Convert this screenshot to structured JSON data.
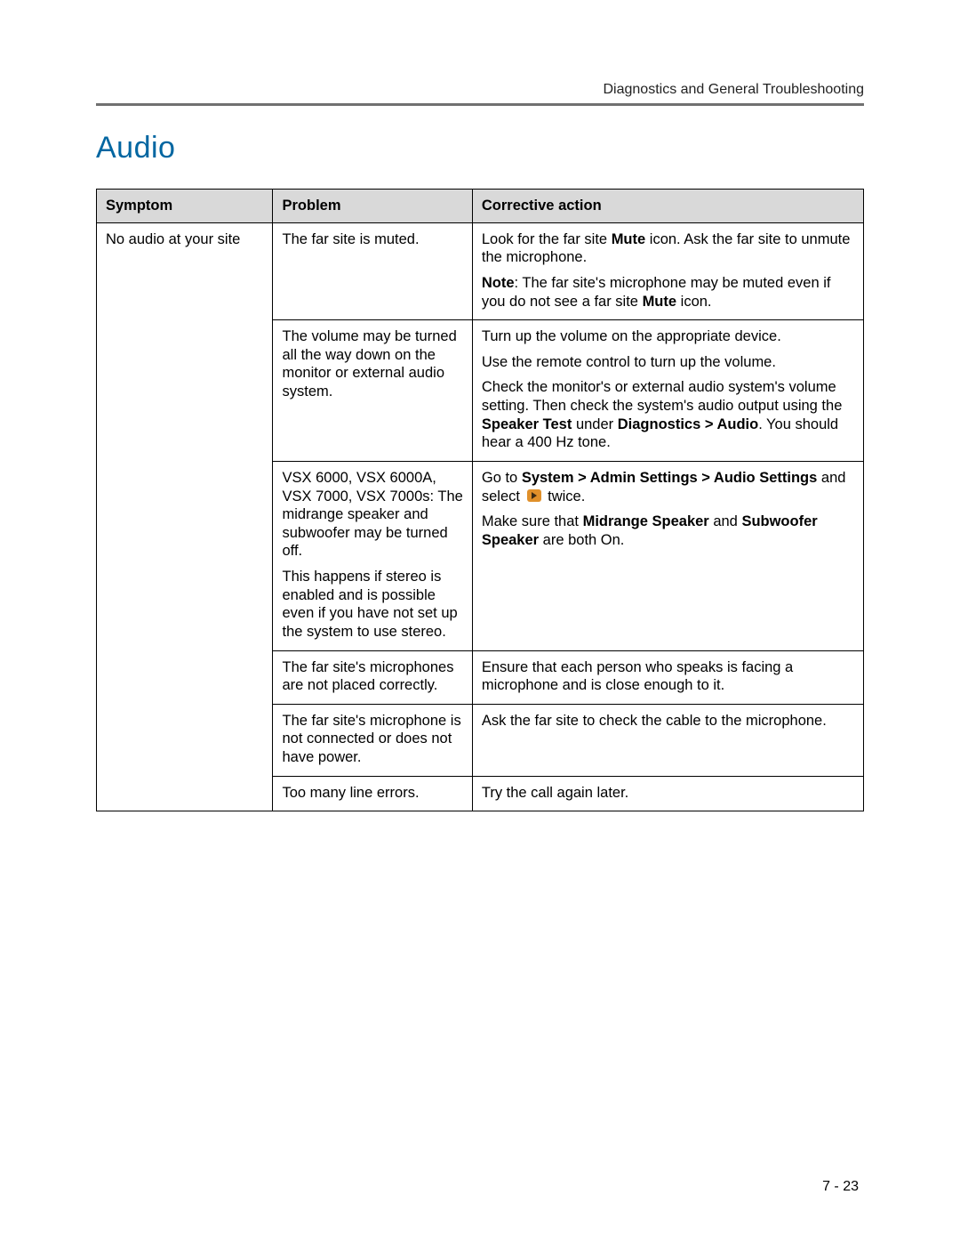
{
  "header": {
    "running": "Diagnostics and General Troubleshooting"
  },
  "section_title": "Audio",
  "table": {
    "headers": {
      "symptom": "Symptom",
      "problem": "Problem",
      "action": "Corrective action"
    },
    "symptom": "No audio at your site",
    "rows": [
      {
        "problem": "The far site is muted.",
        "action": {
          "pre1": "Look for the far site ",
          "b1": "Mute",
          "post1": " icon. Ask the far site to unmute the microphone.",
          "pre2": "Note",
          "post2": ": The far site's microphone may be muted even if you do not see a far site ",
          "b2": "Mute",
          "post3": " icon."
        }
      },
      {
        "problem": "The volume may be turned all the way down on the monitor or external audio system.",
        "action": {
          "p1": "Turn up the volume on the appropriate device.",
          "p2": "Use the remote control to turn up the volume.",
          "pre3": "Check the monitor's or external audio system's volume setting. Then check the system's audio output using the ",
          "b3a": "Speaker Test",
          "mid3": " under ",
          "b3b": "Diagnostics > Audio",
          "post3": ". You should hear a 400 Hz tone."
        }
      },
      {
        "problem_p1": "VSX 6000, VSX 6000A, VSX 7000, VSX 7000s: The midrange speaker and subwoofer may be turned off.",
        "problem_p2": "This happens if stereo is enabled and is possible even if you have not set up the system to use stereo.",
        "action": {
          "pre1": "Go to ",
          "b1": "System > Admin Settings > Audio Settings",
          "mid1": " and select ",
          "post1": " twice.",
          "pre2": "Make sure that ",
          "b2a": "Midrange Speaker",
          "mid2": " and ",
          "b2b": "Subwoofer Speaker",
          "post2": " are both On."
        }
      },
      {
        "problem": "The far site's microphones are not placed correctly.",
        "action": {
          "p": "Ensure that each person who speaks is facing a microphone and is close enough to it."
        }
      },
      {
        "problem": "The far site's microphone is not connected or does not have power.",
        "action": {
          "p": "Ask the far site to check the cable to the microphone."
        }
      },
      {
        "problem": "Too many line errors.",
        "action": {
          "p": "Try the call again later."
        }
      }
    ]
  },
  "page_number": "7 - 23"
}
